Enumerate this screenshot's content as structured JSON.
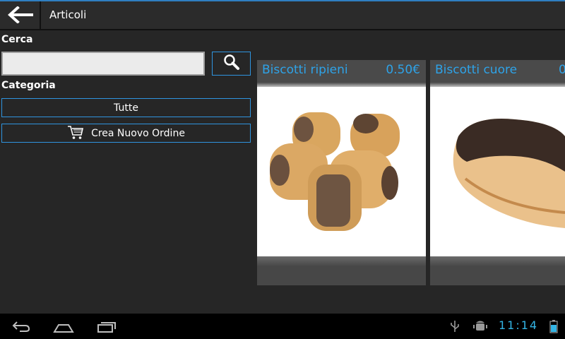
{
  "header": {
    "title": "Articoli",
    "back_icon": "arrow-left-icon"
  },
  "search": {
    "label": "Cerca",
    "value": "",
    "placeholder": "",
    "button_icon": "search-icon"
  },
  "category": {
    "label": "Categoria",
    "selected": "Tutte"
  },
  "order_button": {
    "label": "Crea Nuovo Ordine",
    "icon": "cart-icon"
  },
  "products": [
    {
      "name": "Biscotti ripieni",
      "price": "0.50€"
    },
    {
      "name": "Biscotti cuore",
      "price": "0"
    }
  ],
  "system_bar": {
    "time": "11:14",
    "icons": [
      "back-icon",
      "home-icon",
      "recent-apps-icon",
      "usb-icon",
      "android-debug-icon",
      "battery-icon"
    ]
  },
  "colors": {
    "accent": "#2ea3e8",
    "background": "#262626"
  }
}
